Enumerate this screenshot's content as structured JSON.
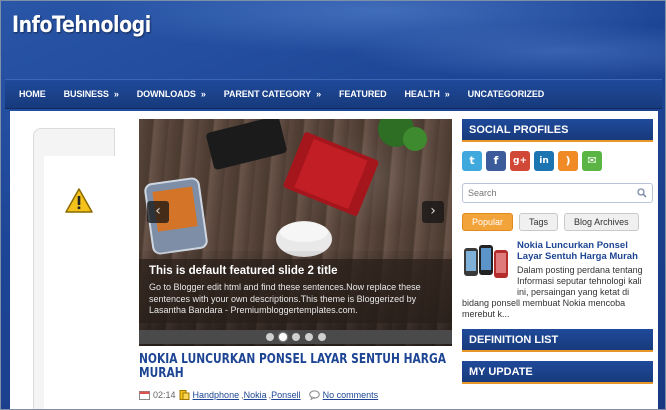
{
  "site": {
    "title": "InfoTehnologi"
  },
  "nav": {
    "items": [
      {
        "label": "HOME",
        "has_sub": false
      },
      {
        "label": "BUSINESS",
        "has_sub": true
      },
      {
        "label": "DOWNLOADS",
        "has_sub": true
      },
      {
        "label": "PARENT CATEGORY",
        "has_sub": true
      },
      {
        "label": "FEATURED",
        "has_sub": false
      },
      {
        "label": "HEALTH",
        "has_sub": true
      },
      {
        "label": "UNCATEGORIZED",
        "has_sub": false
      }
    ],
    "submenu_arrow": "»"
  },
  "slider": {
    "title": "This is default featured slide 2 title",
    "text": "Go to Blogger edit html and find these sentences.Now replace these sentences with your own descriptions.This theme is Bloggerized by Lasantha Bandara - Premiumbloggertemplates.com.",
    "prev_icon": "‹",
    "next_icon": "›",
    "slide_count": 5,
    "active_index": 1
  },
  "post": {
    "title": "NOKIA LUNCURKAN PONSEL LAYAR SENTUH HARGA MURAH",
    "time": "02:14",
    "tags": [
      "Handphone",
      "Nokia",
      "Ponsell"
    ],
    "comments": "No comments"
  },
  "sidebar": {
    "social_profiles_title": "SOCIAL PROFILES",
    "social_icons": [
      {
        "name": "twitter-icon",
        "glyph": "t",
        "color": "#3fa9dd"
      },
      {
        "name": "facebook-icon",
        "glyph": "f",
        "color": "#3b5b9a"
      },
      {
        "name": "googleplus-icon",
        "glyph": "g+",
        "color": "#d14836"
      },
      {
        "name": "linkedin-icon",
        "glyph": "in",
        "color": "#1c74b1"
      },
      {
        "name": "rss-icon",
        "glyph": ")",
        "color": "#f08a24"
      },
      {
        "name": "email-icon",
        "glyph": "✉",
        "color": "#5ab545"
      }
    ],
    "search_placeholder": "Search",
    "tabs": [
      {
        "label": "Popular",
        "active": true
      },
      {
        "label": "Tags",
        "active": false
      },
      {
        "label": "Blog Archives",
        "active": false
      }
    ],
    "popular": {
      "title": "Nokia Luncurkan Ponsel Layar Sentuh Harga Murah",
      "excerpt": "Dalam posting perdana tentang Informasi seputar tehnologi kali ini, persaingan yang ketat di",
      "more": "bidang ponsell membuat Nokia mencoba merebut k..."
    },
    "definition_list_title": "DEFINITION LIST",
    "my_update_title": "MY UPDATE"
  },
  "colors": {
    "brand_blue": "#1d4593",
    "accent_orange": "#e8962a"
  }
}
